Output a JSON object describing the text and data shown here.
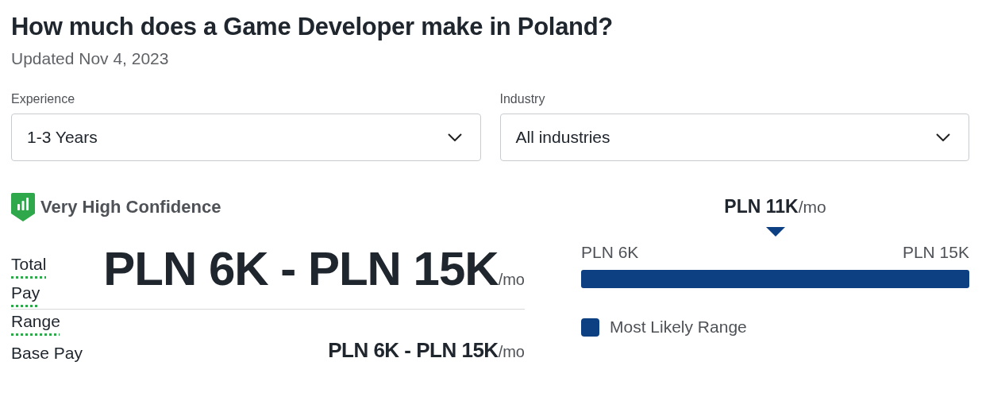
{
  "title": "How much does a Game Developer make in Poland?",
  "updated": "Updated Nov 4, 2023",
  "filters": [
    {
      "label": "Experience",
      "value": "1-3 Years"
    },
    {
      "label": "Industry",
      "value": "All industries"
    }
  ],
  "confidence": {
    "label": "Very High Confidence"
  },
  "pay_rows": [
    {
      "kind": "total",
      "label": "Total Pay Range",
      "value": "PLN 6K - PLN 15K",
      "unit": "/mo"
    },
    {
      "kind": "base",
      "label": "Base Pay",
      "value": "PLN 6K - PLN 15K",
      "unit": "/mo"
    }
  ],
  "range_chart": {
    "median": "PLN 11K",
    "median_unit": "/mo",
    "low": "PLN 6K",
    "high": "PLN 15K",
    "legend": "Most Likely Range"
  }
}
